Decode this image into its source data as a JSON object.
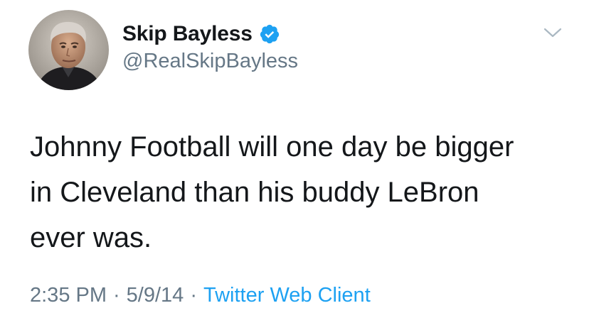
{
  "tweet": {
    "author": {
      "display_name": "Skip Bayless",
      "handle": "@RealSkipBayless",
      "verified_icon": "verified-badge-icon"
    },
    "text_lines": [
      "Johnny Football will one day be bigger",
      "in Cleveland than his buddy LeBron",
      "ever was."
    ],
    "time": "2:35 PM",
    "date": "5/9/14",
    "separator": "·",
    "source": "Twitter Web Client",
    "menu_icon": "chevron-down-icon"
  },
  "colors": {
    "text": "#14171a",
    "secondary": "#657786",
    "link": "#1da1f2",
    "verified": "#1da1f2",
    "background": "#ffffff"
  }
}
